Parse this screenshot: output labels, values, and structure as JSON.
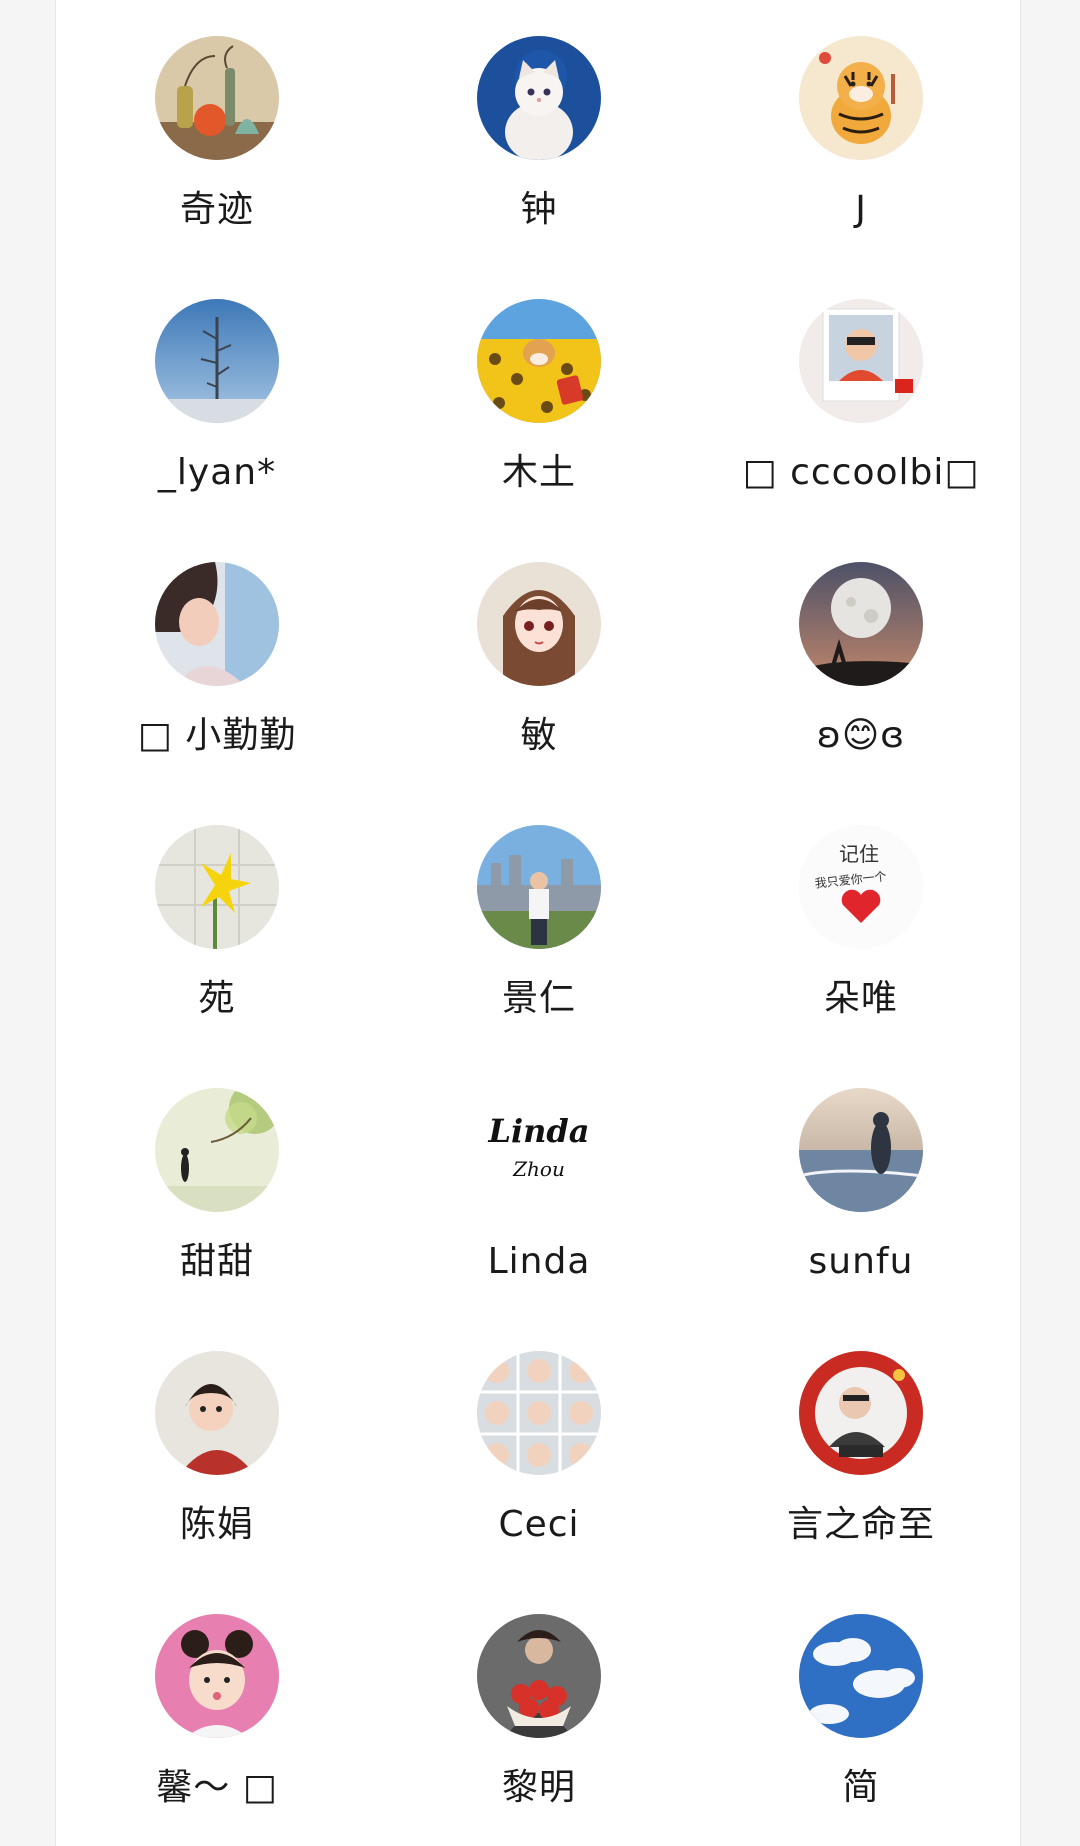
{
  "members": [
    {
      "name": "奇迹",
      "avatar": "vases-still-life-avatar"
    },
    {
      "name": "钟",
      "avatar": "white-kitten-avatar"
    },
    {
      "name": "J",
      "avatar": "cartoon-tiger-avatar"
    },
    {
      "name": "_lyan*",
      "avatar": "plant-sky-avatar"
    },
    {
      "name": "木土",
      "avatar": "shiba-sunflowers-avatar"
    },
    {
      "name": "□ cccoolbi□",
      "avatar": "child-photo-avatar"
    },
    {
      "name": "□ 小勤勤",
      "avatar": "girl-selfie-avatar"
    },
    {
      "name": "敏",
      "avatar": "anime-girl-avatar"
    },
    {
      "name": "ʚ😊ɞ",
      "avatar": "full-moon-avatar"
    },
    {
      "name": "苑",
      "avatar": "yellow-flower-avatar"
    },
    {
      "name": "景仁",
      "avatar": "city-man-avatar"
    },
    {
      "name": "朵唯",
      "avatar": "handwriting-heart-avatar"
    },
    {
      "name": "甜甜",
      "avatar": "tree-silhouette-avatar"
    },
    {
      "name": "Linda",
      "avatar": "linda-zhou-script-avatar"
    },
    {
      "name": "sunfu",
      "avatar": "beach-sunset-avatar"
    },
    {
      "name": "陈娟",
      "avatar": "little-girl-avatar"
    },
    {
      "name": "Ceci",
      "avatar": "baby-collage-avatar"
    },
    {
      "name": "言之命至",
      "avatar": "new-year-frame-avatar"
    },
    {
      "name": "馨～ □",
      "avatar": "pink-girl-avatar"
    },
    {
      "name": "黎明",
      "avatar": "bouquet-avatar"
    },
    {
      "name": "简",
      "avatar": "blue-sky-clouds-avatar"
    }
  ],
  "avatar_texts": {
    "tiger_sticker": "",
    "linda_script": "Linda",
    "zhou_script": "Zhou",
    "handwriting_line1": "记住",
    "handwriting_line2": "我只爱你一个"
  }
}
